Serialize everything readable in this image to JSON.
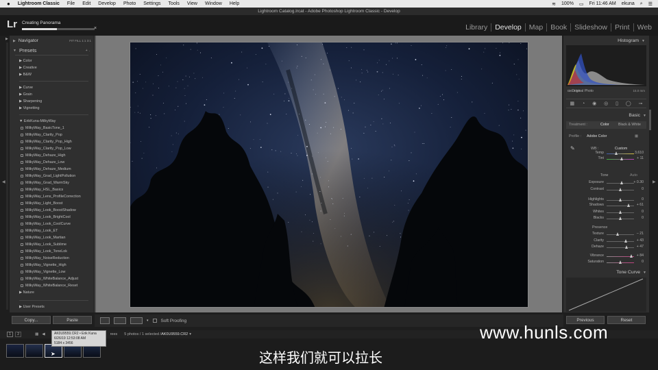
{
  "menubar": {
    "apple": "",
    "items": [
      "Lightroom Classic",
      "File",
      "Edit",
      "Develop",
      "Photo",
      "Settings",
      "Tools",
      "View",
      "Window",
      "Help"
    ],
    "status_battery": "100%",
    "clock": "Fri 11:46 AM",
    "user": "ekuna"
  },
  "window_title": "Lightroom Catalog.lrcat - Adobe Photoshop Lightroom Classic - Develop",
  "identity": {
    "logo": "Lr",
    "task_title": "Creating Panorama",
    "task_progress": 0.48,
    "task_close": "×"
  },
  "modules": [
    "Library",
    "Develop",
    "Map",
    "Book",
    "Slideshow",
    "Print",
    "Web"
  ],
  "active_module": "Develop",
  "left": {
    "navigator_title": "Navigator",
    "navigator_zoom": "FIT   FILL   1:1   3:1",
    "presets_title": "Presets",
    "presets_add": "+.",
    "groups1": [
      "Color",
      "Creative",
      "B&W"
    ],
    "groups2": [
      "Curve",
      "Grain",
      "Sharpening",
      "Vignetting"
    ],
    "folder": "ErikKuna-MilkyWay",
    "presets": [
      "MilkyWay_BasicTone_1",
      "MilkyWay_Clarity_Pop",
      "MilkyWay_Clarity_Pop_High",
      "MilkyWay_Clarity_Pop_Low",
      "MilkyWay_Dehaze_High",
      "MilkyWay_Dehaze_Low",
      "MilkyWay_Dehaze_Medium",
      "MilkyWay_Grad_LightPollution",
      "MilkyWay_Grad_WarmSky",
      "MilkyWay_HSL_Basics",
      "MilkyWay_Lens_ProfileCorrection",
      "MilkyWay_Light_Boost",
      "MilkyWay_Look_BoostShadow",
      "MilkyWay_Look_BrightCool",
      "MilkyWay_Look_CoolCurve",
      "MilkyWay_Look_ET",
      "MilkyWay_Look_Martian",
      "MilkyWay_Look_Sublime",
      "MilkyWay_Look_ToneLok",
      "MilkyWay_NoiseReduction",
      "MilkyWay_Vignette_High",
      "MilkyWay_Vignette_Low",
      "MilkyWay_WhiteBalance_Adjust",
      "MilkyWay_WhiteBalance_Reset"
    ],
    "nature": "Nature",
    "user_presets": "User Presets",
    "copy_button": "Copy...",
    "paste_button": "Paste"
  },
  "toolbar": {
    "soft_proofing": "Soft Proofing"
  },
  "right": {
    "histogram_title": "Histogram",
    "hist_iso": "ISO 6400",
    "hist_focal": "15.0 mm",
    "original_photo": "Original Photo",
    "basic_title": "Basic",
    "treatment_label": "Treatment :",
    "treatment_color": "Color",
    "treatment_bw": "Black & White",
    "profile_label": "Profile :",
    "profile_value": "Adobe Color",
    "wb_label": "WB :",
    "wb_value": "Custom",
    "tone_label": "Tone",
    "tone_auto": "Auto",
    "presence_label": "Presence",
    "sliders": [
      {
        "label": "Temp",
        "value": "3,610",
        "pos": 0.35
      },
      {
        "label": "Tint",
        "value": "+ 11",
        "pos": 0.55
      },
      {
        "label": "Exposure",
        "value": "+ 0.30",
        "pos": 0.55
      },
      {
        "label": "Contrast",
        "value": "0",
        "pos": 0.5
      },
      {
        "label": "Highlights",
        "value": "0",
        "pos": 0.5
      },
      {
        "label": "Shadows",
        "value": "+ 61",
        "pos": 0.8
      },
      {
        "label": "Whites",
        "value": "0",
        "pos": 0.5
      },
      {
        "label": "Blacks",
        "value": "0",
        "pos": 0.5
      },
      {
        "label": "Texture",
        "value": "– 21",
        "pos": 0.4
      },
      {
        "label": "Clarity",
        "value": "+ 43",
        "pos": 0.72
      },
      {
        "label": "Dehaze",
        "value": "+ 47",
        "pos": 0.73
      },
      {
        "label": "Vibrance",
        "value": "+ 84",
        "pos": 0.92
      },
      {
        "label": "Saturation",
        "value": "0",
        "pos": 0.5
      }
    ],
    "tone_curve_title": "Tone Curve",
    "previous_button": "Previous",
    "reset_button": "Reset"
  },
  "filmstrip": {
    "page1": "1",
    "page2": "2",
    "source_prefix": "rees",
    "info": "5 photos / 1 selected / ",
    "filename": "AK0U9559.CR2",
    "tooltip_line1": "AK0U9559.CR2 • Erik Kuna",
    "tooltip_line2": "6/26/19 12:53:08 AM",
    "tooltip_line3": "5184 x 3456"
  },
  "overlay": {
    "watermark": "www.hunls.com",
    "subtitle": "这样我们就可以拉长"
  }
}
